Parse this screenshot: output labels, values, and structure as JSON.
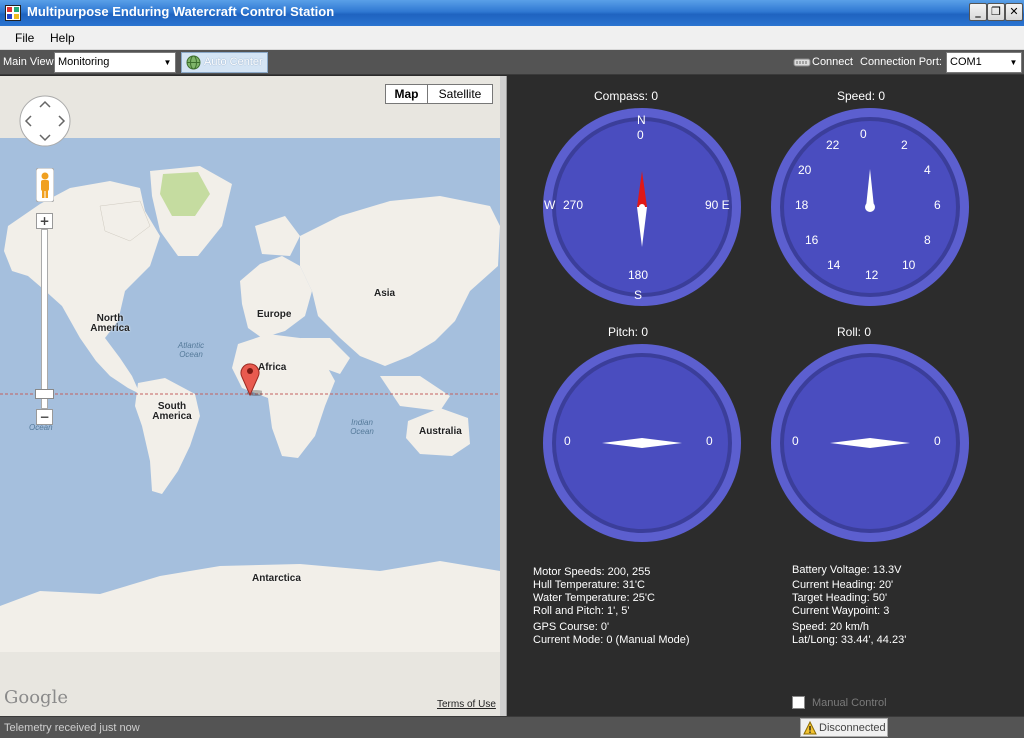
{
  "window": {
    "title": "Multipurpose Enduring Watercraft Control Station",
    "controls": {
      "minimize": "_",
      "restore": "❐",
      "close": "✕"
    }
  },
  "menu": [
    {
      "label": "File"
    },
    {
      "label": "Help"
    }
  ],
  "toolbar": {
    "main_view_label": "Main View",
    "main_view_value": "Monitoring",
    "auto_center_label": "Auto Center",
    "connect_label": "Connect",
    "connection_port_label": "Connection Port:",
    "connection_port_value": "COM1"
  },
  "map": {
    "type_buttons": {
      "map": "Map",
      "satellite": "Satellite"
    },
    "selected_type": "Map",
    "zoom_in": "+",
    "zoom_out": "−",
    "labels": {
      "north_america": "North America",
      "south_america": "South America",
      "europe": "Europe",
      "asia": "Asia",
      "africa": "Africa",
      "australia": "Australia",
      "antarctica": "Antarctica",
      "atlantic_ocean": "Atlantic Ocean",
      "indian_ocean": "Indian Ocean",
      "ocean_fragment": "Ocean"
    },
    "logo": "Google",
    "terms": "Terms of Use",
    "colors": {
      "water": "#a5bfdd",
      "land": "#f2efe9",
      "green": "#c5dca0",
      "marker": "#e85a4f"
    }
  },
  "gauges": {
    "compass": {
      "title": "Compass: 0",
      "labels": {
        "n": "N",
        "n_deg": "0",
        "e": "90 E",
        "w_deg": "270",
        "w": "W",
        "s_deg": "180",
        "s": "S"
      },
      "value": 0
    },
    "speed": {
      "title": "Speed: 0",
      "ticks": [
        "0",
        "2",
        "4",
        "6",
        "8",
        "10",
        "12",
        "14",
        "16",
        "18",
        "20",
        "22"
      ],
      "value": 0
    },
    "pitch": {
      "title": "Pitch: 0",
      "left": "0",
      "right": "0",
      "value": 0
    },
    "roll": {
      "title": "Roll: 0",
      "left": "0",
      "right": "0",
      "value": 0
    },
    "colors": {
      "face": "#4a4dbf",
      "rim": "#5c5fcf",
      "needle": "#ffffff",
      "north": "#e01818"
    }
  },
  "telemetry_left": [
    "Motor Speeds: 200, 255",
    "Hull Temperature: 31'C",
    "Water Temperature: 25'C",
    "Roll and Pitch: 1', 5'",
    "GPS Course: 0'",
    "Current Mode: 0 (Manual Mode)"
  ],
  "telemetry_right": [
    "Battery Voltage: 13.3V",
    "Current Heading: 20'",
    "Target Heading: 50'",
    "Current Waypoint: 3",
    "Speed: 20 km/h",
    "Lat/Long: 33.44', 44.23'"
  ],
  "manual_control": {
    "label": "Manual Control",
    "checked": false
  },
  "status": {
    "message": "Telemetry received just now",
    "connection": "Disconnected"
  }
}
